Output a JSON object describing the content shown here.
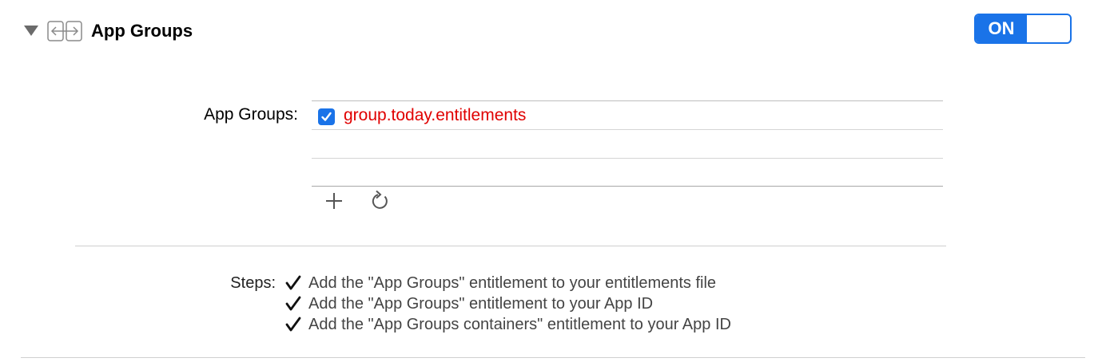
{
  "header": {
    "title": "App Groups",
    "toggle_label": "ON",
    "disclosure_icon": "disclosure-triangle-down",
    "capability_icon": "app-groups-icon"
  },
  "app_groups": {
    "label": "App Groups:",
    "items": [
      {
        "name": "group.today.entitlements",
        "checked": true
      }
    ],
    "add_icon": "plus-icon",
    "refresh_icon": "refresh-icon"
  },
  "steps": {
    "label": "Steps:",
    "items": [
      "Add the \"App Groups\" entitlement to your entitlements file",
      "Add the \"App Groups\" entitlement to your App ID",
      "Add the \"App Groups containers\" entitlement to your App ID"
    ]
  },
  "colors": {
    "accent": "#1a73e8",
    "error_text": "#e00000"
  }
}
